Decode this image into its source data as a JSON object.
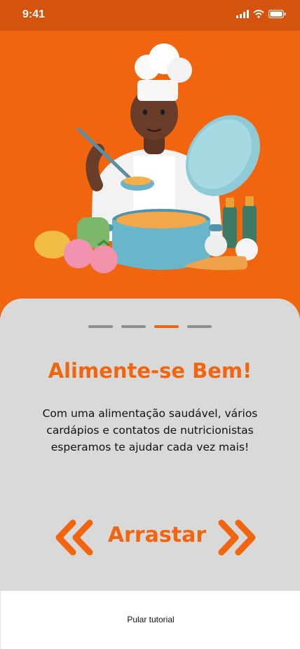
{
  "status": {
    "time": "9:41"
  },
  "hero": {
    "illustration": "chef-cooking-illustration"
  },
  "pager": {
    "total": 4,
    "active_index": 2
  },
  "onboarding": {
    "title": "Alimente-se Bem!",
    "description": "Com uma alimentação saudável, vários cardápios e contatos de nutricionistas esperamos te ajudar cada vez mais!",
    "swipe_label": "Arrastar"
  },
  "footer": {
    "skip_label": "Pular tutorial"
  },
  "colors": {
    "accent": "#f2650f",
    "status_bar": "#d3530f",
    "card": "#d9d9d9"
  }
}
